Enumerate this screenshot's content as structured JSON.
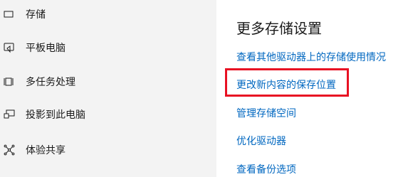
{
  "sidebar": {
    "items": [
      {
        "label": "存储",
        "icon": "storage-icon"
      },
      {
        "label": "平板电脑",
        "icon": "tablet-icon"
      },
      {
        "label": "多任务处理",
        "icon": "multitasking-icon"
      },
      {
        "label": "投影到此电脑",
        "icon": "projection-icon"
      },
      {
        "label": "体验共享",
        "icon": "shared-experiences-icon"
      }
    ]
  },
  "main": {
    "section_title": "更多存储设置",
    "links": [
      {
        "label": "查看其他驱动器上的存储使用情况"
      },
      {
        "label": "更改新内容的保存位置",
        "highlighted": true
      },
      {
        "label": "管理存储空间"
      },
      {
        "label": "优化驱动器"
      },
      {
        "label": "查看备份选项"
      }
    ]
  },
  "colors": {
    "sidebar_bg": "#f3f3f3",
    "link": "#0067c0",
    "highlight_border": "#e81123",
    "text": "#1a1a1a"
  }
}
